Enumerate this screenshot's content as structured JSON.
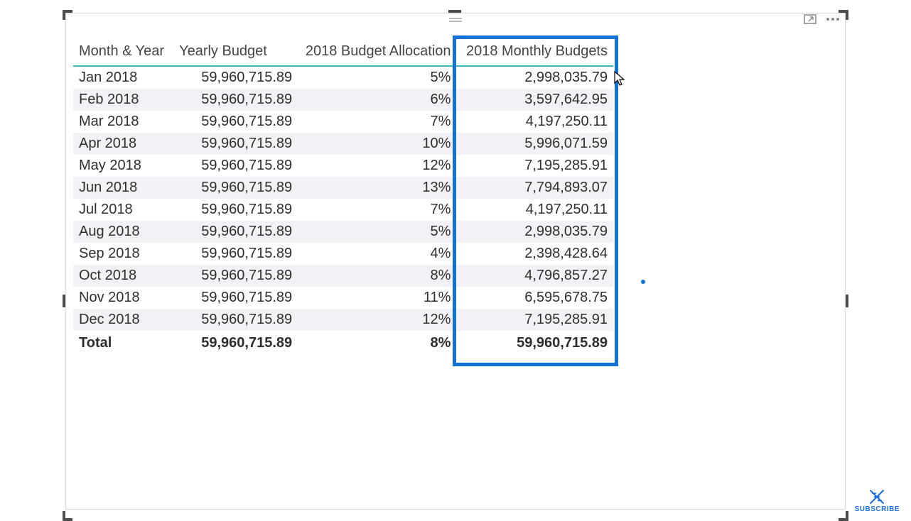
{
  "table": {
    "headers": {
      "month_year": "Month & Year",
      "yearly_budget": "Yearly Budget",
      "allocation": "2018 Budget Allocation",
      "monthly_budget": "2018 Monthly Budgets"
    },
    "rows": [
      {
        "month": "Jan 2018",
        "yearly": "59,960,715.89",
        "alloc": "5%",
        "monthly": "2,998,035.79"
      },
      {
        "month": "Feb 2018",
        "yearly": "59,960,715.89",
        "alloc": "6%",
        "monthly": "3,597,642.95"
      },
      {
        "month": "Mar 2018",
        "yearly": "59,960,715.89",
        "alloc": "7%",
        "monthly": "4,197,250.11"
      },
      {
        "month": "Apr 2018",
        "yearly": "59,960,715.89",
        "alloc": "10%",
        "monthly": "5,996,071.59"
      },
      {
        "month": "May 2018",
        "yearly": "59,960,715.89",
        "alloc": "12%",
        "monthly": "7,195,285.91"
      },
      {
        "month": "Jun 2018",
        "yearly": "59,960,715.89",
        "alloc": "13%",
        "monthly": "7,794,893.07"
      },
      {
        "month": "Jul 2018",
        "yearly": "59,960,715.89",
        "alloc": "7%",
        "monthly": "4,197,250.11"
      },
      {
        "month": "Aug 2018",
        "yearly": "59,960,715.89",
        "alloc": "5%",
        "monthly": "2,998,035.79"
      },
      {
        "month": "Sep 2018",
        "yearly": "59,960,715.89",
        "alloc": "4%",
        "monthly": "2,398,428.64"
      },
      {
        "month": "Oct 2018",
        "yearly": "59,960,715.89",
        "alloc": "8%",
        "monthly": "4,796,857.27"
      },
      {
        "month": "Nov 2018",
        "yearly": "59,960,715.89",
        "alloc": "11%",
        "monthly": "6,595,678.75"
      },
      {
        "month": "Dec 2018",
        "yearly": "59,960,715.89",
        "alloc": "12%",
        "monthly": "7,195,285.91"
      }
    ],
    "total": {
      "label": "Total",
      "yearly": "59,960,715.89",
      "alloc": "8%",
      "monthly": "59,960,715.89"
    }
  },
  "badge": {
    "label": "SUBSCRIBE"
  }
}
